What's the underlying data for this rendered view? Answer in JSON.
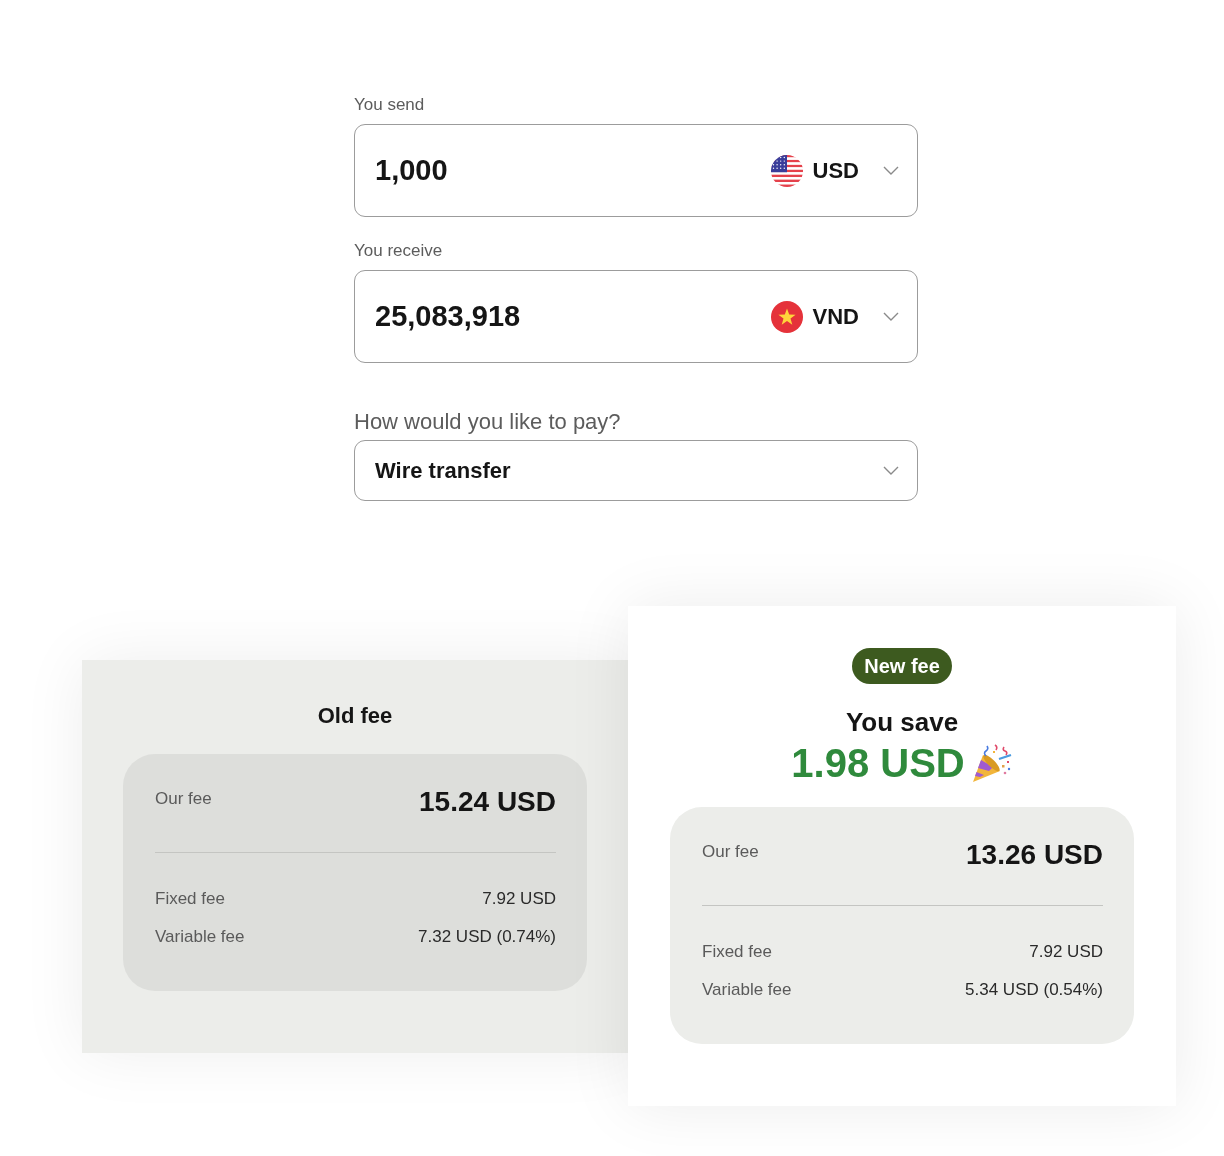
{
  "transfer_form": {
    "amount_fields": [
      {
        "label": "You send",
        "value": "1,000",
        "currency": "USD"
      },
      {
        "label": "You receive",
        "value": "25,083,918",
        "currency": "VND"
      }
    ],
    "payment_method": {
      "label": "How would you like to pay?",
      "value": "Wire transfer"
    }
  },
  "fee_cards": [
    {
      "kind": "old",
      "title": "Old fee",
      "our_fee": {
        "label": "Our fee",
        "value": "15.24 USD"
      },
      "breakdown": [
        {
          "label": "Fixed fee",
          "value": "7.92 USD"
        },
        {
          "label": "Variable fee",
          "value": "7.32 USD (0.74%)"
        }
      ]
    },
    {
      "kind": "new",
      "badge": "New fee",
      "title": "You save",
      "savings": "1.98 USD",
      "our_fee": {
        "label": "Our fee",
        "value": "13.26 USD"
      },
      "breakdown": [
        {
          "label": "Fixed fee",
          "value": "7.92 USD"
        },
        {
          "label": "Variable fee",
          "value": "5.34 USD (0.54%)"
        }
      ]
    }
  ]
}
